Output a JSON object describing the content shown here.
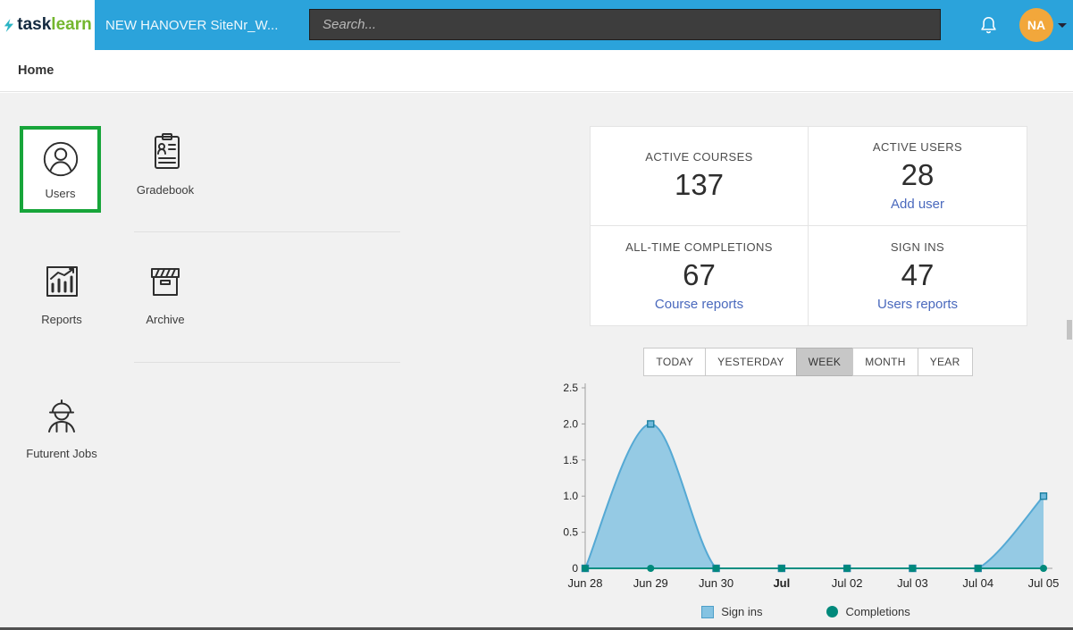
{
  "header": {
    "logo_task": "task",
    "logo_learn": "learn",
    "site_name": "NEW HANOVER SiteNr_W...",
    "search_placeholder": "Search...",
    "avatar_initials": "NA"
  },
  "breadcrumb": {
    "home": "Home"
  },
  "tiles": [
    {
      "label": "Users",
      "highlighted": true
    },
    {
      "label": "Gradebook"
    },
    {
      "label": "Reports"
    },
    {
      "label": "Archive"
    },
    {
      "label": "Futurent Jobs"
    }
  ],
  "stats": [
    {
      "label": "ACTIVE COURSES",
      "value": "137"
    },
    {
      "label": "ACTIVE USERS",
      "value": "28",
      "link": "Add user"
    },
    {
      "label": "ALL-TIME COMPLETIONS",
      "value": "67",
      "link": "Course reports"
    },
    {
      "label": "SIGN INS",
      "value": "47",
      "link": "Users reports"
    }
  ],
  "range_buttons": [
    {
      "label": "TODAY"
    },
    {
      "label": "YESTERDAY"
    },
    {
      "label": "WEEK",
      "active": true
    },
    {
      "label": "MONTH"
    },
    {
      "label": "YEAR"
    }
  ],
  "chart_data": {
    "type": "area",
    "categories": [
      "Jun 28",
      "Jun 29",
      "Jun 30",
      "Jul",
      "Jul 02",
      "Jul 03",
      "Jul 04",
      "Jul 05"
    ],
    "bold_category": "Jul",
    "series": [
      {
        "name": "Sign ins",
        "values": [
          0,
          2,
          0,
          0,
          0,
          0,
          0,
          1
        ],
        "color": "#85c3e2",
        "line_color": "#55a9d4",
        "marker": "square"
      },
      {
        "name": "Completions",
        "values": [
          0,
          0,
          0,
          0,
          0,
          0,
          0,
          0
        ],
        "color": "#00897b",
        "line_color": "#0a8f82",
        "marker": "circle"
      }
    ],
    "ylim": [
      0,
      2.5
    ],
    "yticks": [
      0,
      0.5,
      1,
      1.5,
      2,
      2.5
    ],
    "grid": false,
    "legend_position": "bottom"
  },
  "colors": {
    "header_blue": "#2BA3DB",
    "link_blue": "#4a69bd",
    "highlight_green": "#17a53a",
    "avatar_orange": "#F2A73B",
    "area_fill": "#85c3e2",
    "completions_teal": "#00897b"
  }
}
